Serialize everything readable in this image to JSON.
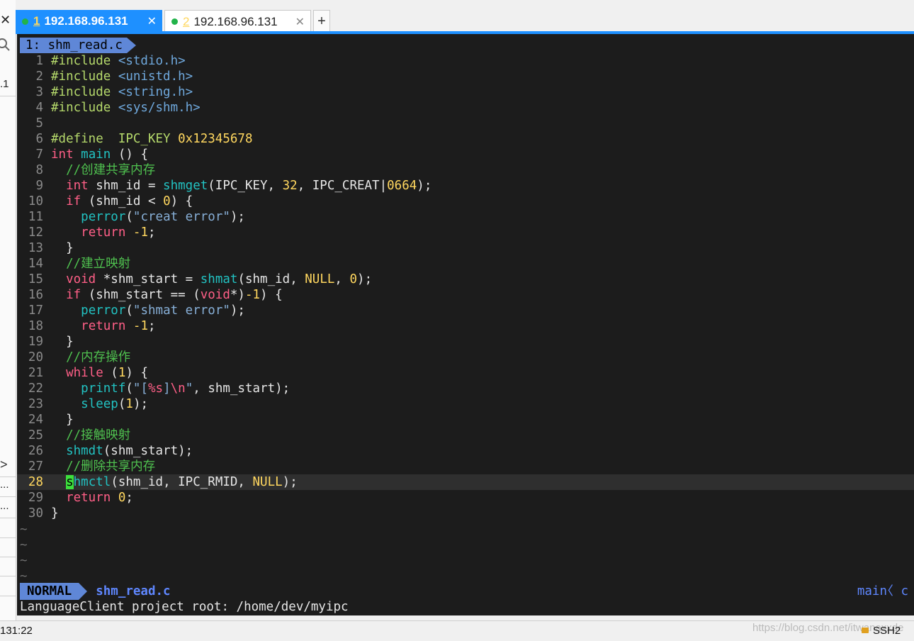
{
  "tabs": [
    {
      "num": "1",
      "host": "192.168.96.131",
      "active": true
    },
    {
      "num": "2",
      "host": "192.168.96.131",
      "active": false
    }
  ],
  "add_tab_label": "+",
  "left_panel": {
    "fragments": [
      ".1",
      "...",
      "..."
    ],
    "chevron": ">"
  },
  "editor": {
    "tab_label": "1: shm_read.c",
    "current_line": 28,
    "empty_marker": "~",
    "lines": [
      {
        "n": "1",
        "tokens": [
          {
            "t": "#include ",
            "c": "pp"
          },
          {
            "t": "<stdio.h>",
            "c": "inc"
          }
        ]
      },
      {
        "n": "2",
        "tokens": [
          {
            "t": "#include ",
            "c": "pp"
          },
          {
            "t": "<unistd.h>",
            "c": "inc"
          }
        ]
      },
      {
        "n": "3",
        "tokens": [
          {
            "t": "#include ",
            "c": "pp"
          },
          {
            "t": "<string.h>",
            "c": "inc"
          }
        ]
      },
      {
        "n": "4",
        "tokens": [
          {
            "t": "#include ",
            "c": "pp"
          },
          {
            "t": "<sys/shm.h>",
            "c": "inc"
          }
        ]
      },
      {
        "n": "5",
        "tokens": []
      },
      {
        "n": "6",
        "tokens": [
          {
            "t": "#define  IPC_KEY ",
            "c": "pp"
          },
          {
            "t": "0x12345678",
            "c": "def"
          }
        ]
      },
      {
        "n": "7",
        "tokens": [
          {
            "t": "int",
            "c": "ty"
          },
          {
            "t": " ",
            "c": ""
          },
          {
            "t": "main",
            "c": "fn"
          },
          {
            "t": " () {",
            "c": ""
          }
        ]
      },
      {
        "n": "8",
        "tokens": [
          {
            "t": "  //创建共享内存",
            "c": "cm"
          }
        ]
      },
      {
        "n": "9",
        "tokens": [
          {
            "t": "  ",
            "c": ""
          },
          {
            "t": "int",
            "c": "ty"
          },
          {
            "t": " shm_id = ",
            "c": ""
          },
          {
            "t": "shmget",
            "c": "fn"
          },
          {
            "t": "(IPC_KEY, ",
            "c": ""
          },
          {
            "t": "32",
            "c": "num"
          },
          {
            "t": ", IPC_CREAT|",
            "c": ""
          },
          {
            "t": "0664",
            "c": "num"
          },
          {
            "t": ");",
            "c": ""
          }
        ]
      },
      {
        "n": "10",
        "tokens": [
          {
            "t": "  ",
            "c": ""
          },
          {
            "t": "if",
            "c": "kw"
          },
          {
            "t": " (shm_id < ",
            "c": ""
          },
          {
            "t": "0",
            "c": "num"
          },
          {
            "t": ") {",
            "c": ""
          }
        ]
      },
      {
        "n": "11",
        "tokens": [
          {
            "t": "    ",
            "c": ""
          },
          {
            "t": "perror",
            "c": "fn"
          },
          {
            "t": "(",
            "c": ""
          },
          {
            "t": "\"creat error\"",
            "c": "str"
          },
          {
            "t": ");",
            "c": ""
          }
        ]
      },
      {
        "n": "12",
        "tokens": [
          {
            "t": "    ",
            "c": ""
          },
          {
            "t": "return",
            "c": "kw"
          },
          {
            "t": " ",
            "c": ""
          },
          {
            "t": "-1",
            "c": "num"
          },
          {
            "t": ";",
            "c": ""
          }
        ]
      },
      {
        "n": "13",
        "tokens": [
          {
            "t": "  }",
            "c": ""
          }
        ]
      },
      {
        "n": "14",
        "tokens": [
          {
            "t": "  //建立映射",
            "c": "cm"
          }
        ]
      },
      {
        "n": "15",
        "tokens": [
          {
            "t": "  ",
            "c": ""
          },
          {
            "t": "void",
            "c": "ty"
          },
          {
            "t": " *shm_start = ",
            "c": ""
          },
          {
            "t": "shmat",
            "c": "fn"
          },
          {
            "t": "(shm_id, ",
            "c": ""
          },
          {
            "t": "NULL",
            "c": "nl"
          },
          {
            "t": ", ",
            "c": ""
          },
          {
            "t": "0",
            "c": "num"
          },
          {
            "t": ");",
            "c": ""
          }
        ]
      },
      {
        "n": "16",
        "tokens": [
          {
            "t": "  ",
            "c": ""
          },
          {
            "t": "if",
            "c": "kw"
          },
          {
            "t": " (shm_start == (",
            "c": ""
          },
          {
            "t": "void",
            "c": "ty"
          },
          {
            "t": "*)",
            "c": ""
          },
          {
            "t": "-1",
            "c": "num"
          },
          {
            "t": ") {",
            "c": ""
          }
        ]
      },
      {
        "n": "17",
        "tokens": [
          {
            "t": "    ",
            "c": ""
          },
          {
            "t": "perror",
            "c": "fn"
          },
          {
            "t": "(",
            "c": ""
          },
          {
            "t": "\"shmat error\"",
            "c": "str"
          },
          {
            "t": ");",
            "c": ""
          }
        ]
      },
      {
        "n": "18",
        "tokens": [
          {
            "t": "    ",
            "c": ""
          },
          {
            "t": "return",
            "c": "kw"
          },
          {
            "t": " ",
            "c": ""
          },
          {
            "t": "-1",
            "c": "num"
          },
          {
            "t": ";",
            "c": ""
          }
        ]
      },
      {
        "n": "19",
        "tokens": [
          {
            "t": "  }",
            "c": ""
          }
        ]
      },
      {
        "n": "20",
        "tokens": [
          {
            "t": "  //内存操作",
            "c": "cm"
          }
        ]
      },
      {
        "n": "21",
        "tokens": [
          {
            "t": "  ",
            "c": ""
          },
          {
            "t": "while",
            "c": "kw"
          },
          {
            "t": " (",
            "c": ""
          },
          {
            "t": "1",
            "c": "num"
          },
          {
            "t": ") {",
            "c": ""
          }
        ]
      },
      {
        "n": "22",
        "tokens": [
          {
            "t": "    ",
            "c": ""
          },
          {
            "t": "printf",
            "c": "fn"
          },
          {
            "t": "(",
            "c": ""
          },
          {
            "t": "\"[",
            "c": "str"
          },
          {
            "t": "%s",
            "c": "esc"
          },
          {
            "t": "]",
            "c": "str"
          },
          {
            "t": "\\n",
            "c": "esc"
          },
          {
            "t": "\"",
            "c": "str"
          },
          {
            "t": ", shm_start);",
            "c": ""
          }
        ]
      },
      {
        "n": "23",
        "tokens": [
          {
            "t": "    ",
            "c": ""
          },
          {
            "t": "sleep",
            "c": "fn"
          },
          {
            "t": "(",
            "c": ""
          },
          {
            "t": "1",
            "c": "num"
          },
          {
            "t": ");",
            "c": ""
          }
        ]
      },
      {
        "n": "24",
        "tokens": [
          {
            "t": "  }",
            "c": ""
          }
        ]
      },
      {
        "n": "25",
        "tokens": [
          {
            "t": "  //接触映射",
            "c": "cm"
          }
        ]
      },
      {
        "n": "26",
        "tokens": [
          {
            "t": "  ",
            "c": ""
          },
          {
            "t": "shmdt",
            "c": "fn"
          },
          {
            "t": "(shm_start);",
            "c": ""
          }
        ]
      },
      {
        "n": "27",
        "tokens": [
          {
            "t": "  //删除共享内存",
            "c": "cm"
          }
        ]
      },
      {
        "n": "28",
        "tokens": [
          {
            "t": "  ",
            "c": ""
          },
          {
            "t": "s",
            "c": "cursor"
          },
          {
            "t": "hmctl",
            "c": "fn"
          },
          {
            "t": "(shm_id, IPC_RMID, ",
            "c": ""
          },
          {
            "t": "NULL",
            "c": "nl"
          },
          {
            "t": ");",
            "c": ""
          }
        ]
      },
      {
        "n": "29",
        "tokens": [
          {
            "t": "  ",
            "c": ""
          },
          {
            "t": "return",
            "c": "kw"
          },
          {
            "t": " ",
            "c": ""
          },
          {
            "t": "0",
            "c": "num"
          },
          {
            "t": ";",
            "c": ""
          }
        ]
      },
      {
        "n": "30",
        "tokens": [
          {
            "t": "}",
            "c": ""
          }
        ]
      }
    ],
    "status": {
      "mode": "NORMAL",
      "filename": "shm_read.c",
      "branch": "main",
      "separator": "〈 c"
    },
    "message": "LanguageClient project root: /home/dev/myipc"
  },
  "window_status": {
    "cursor_pos": "131:22",
    "watermark": "https://blog.csdn.net/itwanaxxde",
    "protocol": "SSH2"
  }
}
